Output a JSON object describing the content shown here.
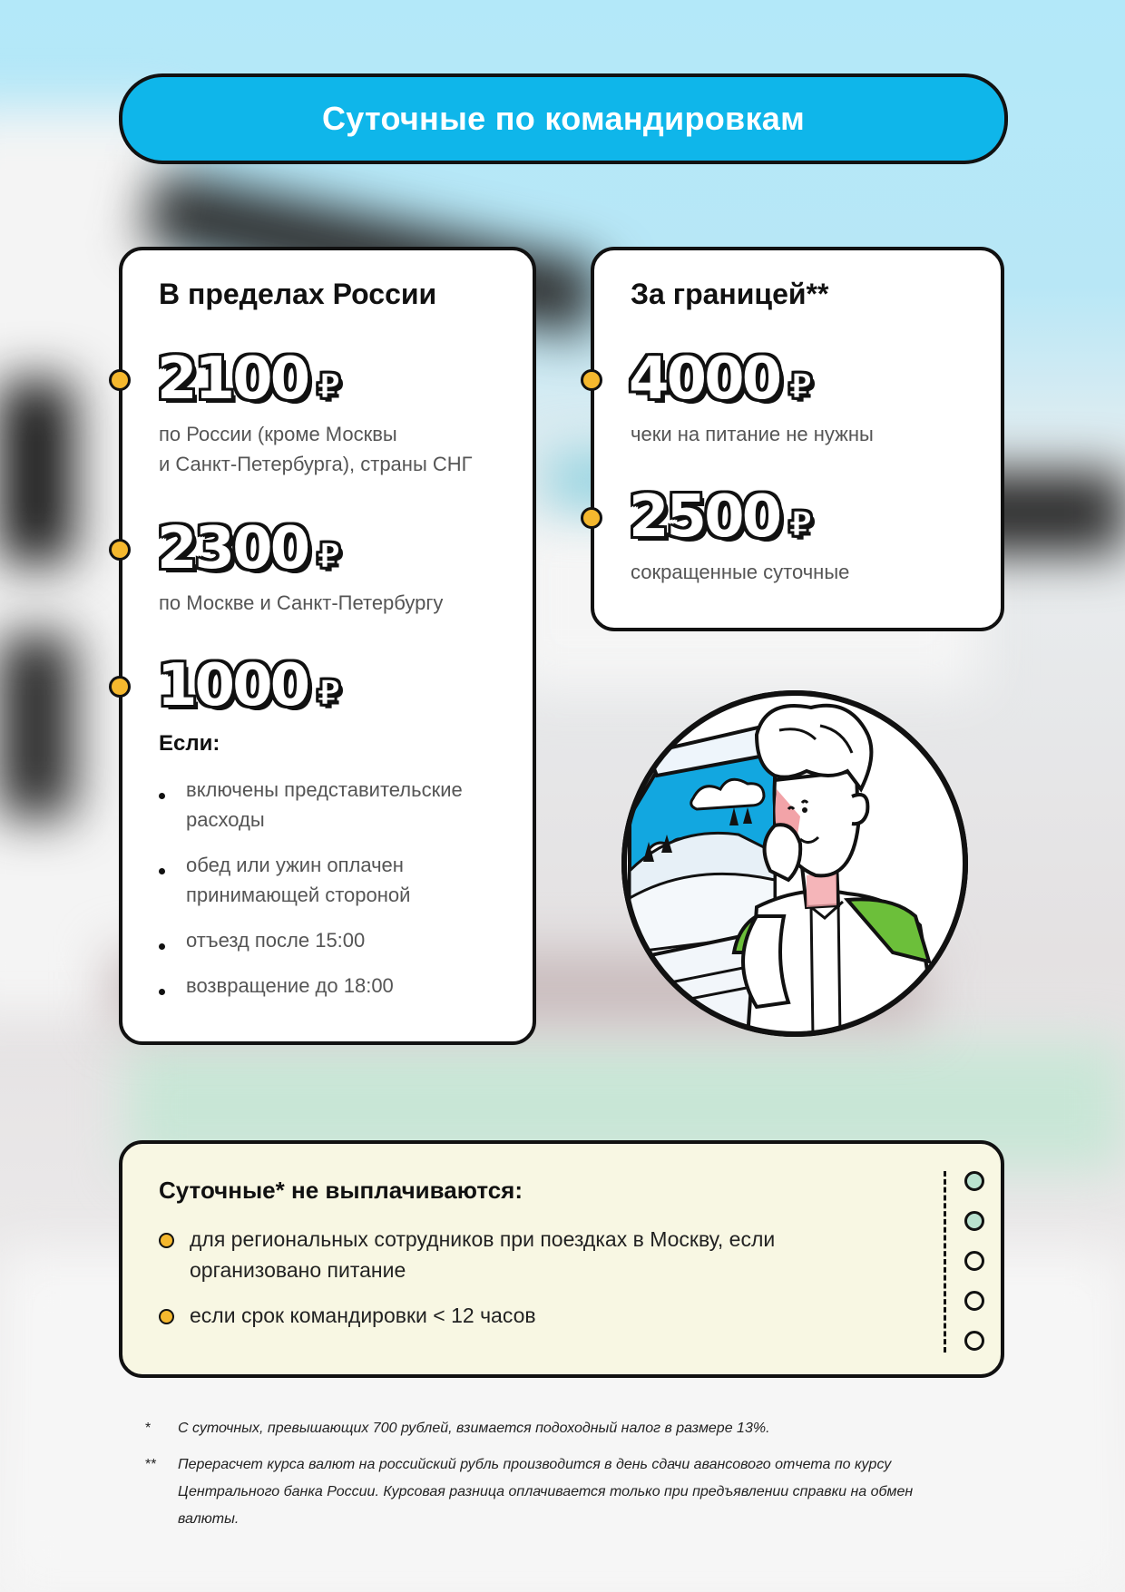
{
  "title": "Суточные по командировкам",
  "russia": {
    "heading": "В пределах России",
    "items": [
      {
        "amount": "2100",
        "currency": "₽",
        "desc_line1": "по России (кроме Москвы",
        "desc_line2": "и Санкт-Петербурга), страны СНГ"
      },
      {
        "amount": "2300",
        "currency": "₽",
        "desc_line1": "по Москве и Санкт-Петербургу"
      },
      {
        "amount": "1000",
        "currency": "₽"
      }
    ],
    "if_label": "Если:",
    "conditions": [
      {
        "line1": "включены представительские",
        "line2": "расходы"
      },
      {
        "line1": "обед или ужин оплачен",
        "line2": "принимающей стороной"
      },
      {
        "line1": "отъезд после 15:00"
      },
      {
        "line1": "возвращение до 18:00"
      }
    ]
  },
  "abroad": {
    "heading": "За границей**",
    "items": [
      {
        "amount": "4000",
        "currency": "₽",
        "desc": "чеки на питание не нужны"
      },
      {
        "amount": "2500",
        "currency": "₽",
        "desc": "сокращенные суточные"
      }
    ]
  },
  "not_paid": {
    "heading": "Суточные* не выплачиваются:",
    "items": [
      {
        "line1": "для региональных сотрудников при поездках в Москву, если",
        "line2": "организовано питание"
      },
      {
        "line1": "если срок командировки < 12 часов"
      }
    ]
  },
  "footnotes": [
    {
      "mark": "*",
      "text": "С суточных, превышающих 700 рублей, взимается подоходный налог в размере 13%."
    },
    {
      "mark": "**",
      "text": "Перерасчет курса валют на российский рубль производится в день сдачи авансового отчета по курсу Центрального банка России. Курсовая разница оплачивается только при предъявлении справки на обмен валюты."
    }
  ],
  "colors": {
    "title_bar": "#0fb6ea",
    "accent_dot": "#f5b82e",
    "note_bg": "#f8f7e3",
    "shirt_green": "#6cbf3a"
  }
}
